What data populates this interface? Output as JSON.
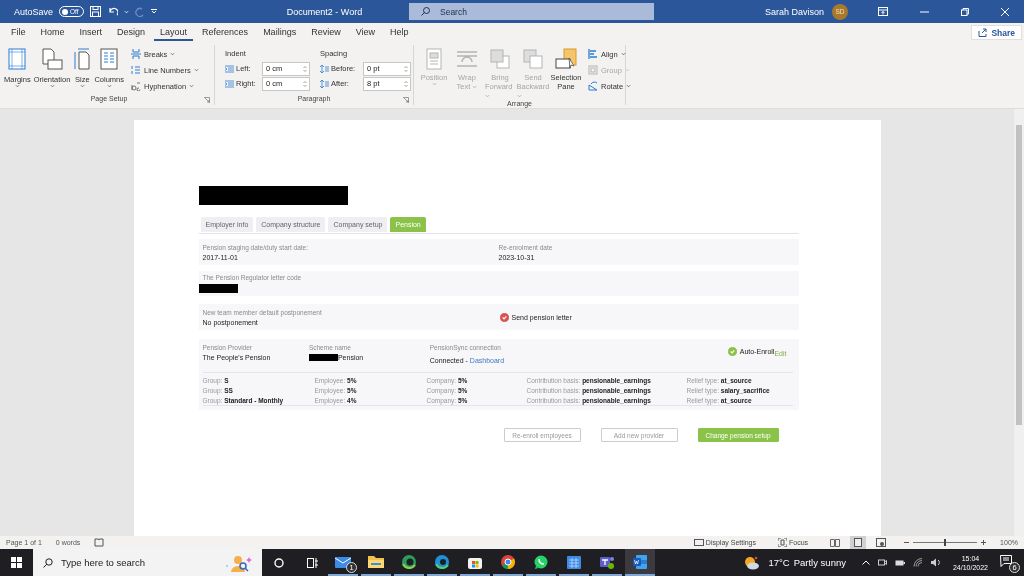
{
  "title_bar": {
    "autosave_label": "AutoSave",
    "autosave": {
      "label": "Off",
      "on": false
    },
    "document_title": "Document2  -  Word",
    "search": {
      "placeholder": "Search"
    },
    "user_name": "Sarah Davison",
    "initials": "SD"
  },
  "menu_tabs": [
    {
      "label": "File",
      "selected": false
    },
    {
      "label": "Home",
      "selected": false
    },
    {
      "label": "Insert",
      "selected": false
    },
    {
      "label": "Design",
      "selected": false
    },
    {
      "label": "Layout",
      "selected": true
    },
    {
      "label": "References",
      "selected": false
    },
    {
      "label": "Mailings",
      "selected": false
    },
    {
      "label": "Review",
      "selected": false
    },
    {
      "label": "View",
      "selected": false
    },
    {
      "label": "Help",
      "selected": false
    }
  ],
  "share": "Share",
  "ribbon": {
    "page_setup": {
      "label": "Page Setup",
      "large_buttons": [
        {
          "label": "Margins"
        },
        {
          "label": "Orientation"
        },
        {
          "label": "Size"
        },
        {
          "label": "Columns"
        }
      ],
      "small_buttons": [
        {
          "label": "Breaks"
        },
        {
          "label": "Line Numbers"
        },
        {
          "label": "Hyphenation"
        }
      ]
    },
    "paragraph": {
      "label": "Paragraph",
      "indent": {
        "heading": "Indent",
        "fields": [
          {
            "label": "Left:",
            "value": "0 cm"
          },
          {
            "label": "Right:",
            "value": "0 cm"
          }
        ]
      },
      "spacing": {
        "heading": "Spacing",
        "fields": [
          {
            "label": "Before:",
            "value": "0 pt"
          },
          {
            "label": "After:",
            "value": "8 pt"
          }
        ]
      }
    },
    "arrange": {
      "label": "Arrange",
      "large_buttons": [
        {
          "lines": [
            "Position"
          ],
          "disabled": true,
          "dropdown": true
        },
        {
          "lines": [
            "Wrap",
            "Text"
          ],
          "disabled": true,
          "dropdown": true
        },
        {
          "lines": [
            "Bring",
            "Forward"
          ],
          "disabled": true,
          "dropdown": true
        },
        {
          "lines": [
            "Send",
            "Backward"
          ],
          "disabled": true,
          "dropdown": true
        },
        {
          "lines": [
            "Selection",
            "Pane"
          ],
          "disabled": false,
          "dropdown": false
        }
      ],
      "small_buttons": [
        {
          "label": "Align",
          "disabled": false
        },
        {
          "label": "Group",
          "disabled": true
        },
        {
          "label": "Rotate",
          "disabled": false
        }
      ]
    }
  },
  "document": {
    "heading": {
      "redacted": true
    },
    "tabs": [
      {
        "label": "Employer info",
        "selected": false
      },
      {
        "label": "Company structure",
        "selected": false
      },
      {
        "label": "Company setup",
        "selected": false
      },
      {
        "label": "Pension",
        "selected": true
      }
    ],
    "dates_card": [
      {
        "label": "Pension staging date/duty start date:",
        "value": "2017-11-01"
      },
      {
        "label": "Re-enrolment date",
        "value": "2023-10-31"
      }
    ],
    "letter_code": {
      "label": "The Pension Regulator letter code",
      "redacted": true
    },
    "postponement": {
      "label": "New team member default postponement",
      "value": "No postponement",
      "send_letter": {
        "label": "Send pension letter",
        "checked": true
      }
    },
    "provider": {
      "provider_label": "Pension Provider",
      "provider": "The People's Pension",
      "scheme_label": "Scheme name",
      "scheme": {
        "redacted": true,
        "text": "Pension"
      },
      "connection_label": "PensionSync connection",
      "connection": "Connected - ",
      "dashboard_link": "Dashboard",
      "auto_enroll": {
        "label": "Auto-Enroll",
        "checked": true
      },
      "edit": "Edit",
      "groups": [
        [
          {
            "label": "Group: ",
            "value": "S"
          },
          {
            "label": "Employee: ",
            "value": "5%"
          },
          {
            "label": "Company: ",
            "value": "5%"
          },
          {
            "label": "Contribution basis: ",
            "value": "pensionable_earnings"
          },
          {
            "label": "Relief type: ",
            "value": "at_source"
          }
        ],
        [
          {
            "label": "Group: ",
            "value": "SS"
          },
          {
            "label": "Employee: ",
            "value": "5%"
          },
          {
            "label": "Company: ",
            "value": "5%"
          },
          {
            "label": "Contribution basis: ",
            "value": "pensionable_earnings"
          },
          {
            "label": "Relief type: ",
            "value": "salary_sacrifice"
          }
        ],
        [
          {
            "label": "Group: ",
            "value": "Standard - Monthly"
          },
          {
            "label": "Employee: ",
            "value": "4%"
          },
          {
            "label": "Company: ",
            "value": "5%"
          },
          {
            "label": "Contribution basis: ",
            "value": "pensionable_earnings"
          },
          {
            "label": "Relief type: ",
            "value": "at_source"
          }
        ]
      ]
    },
    "buttons": [
      {
        "label": "Re-enroll employees",
        "kind": "secondary"
      },
      {
        "label": "Add new provider",
        "kind": "secondary"
      },
      {
        "label": "Change pension setup",
        "kind": "primary"
      }
    ]
  },
  "status_bar": {
    "page": "Page 1 of 1",
    "words": "0 words",
    "display_settings": "Display Settings",
    "focus": "Focus",
    "zoom": {
      "level": 0.5
    },
    "zoom_reading": "100%"
  },
  "taskbar": {
    "search": {
      "placeholder": "Type here to search"
    },
    "apps": [
      {
        "badge": "1",
        "active": false
      },
      {
        "active": false
      },
      {
        "active": false
      },
      {
        "active": false
      },
      {
        "active": false
      },
      {
        "active": false
      },
      {
        "active": false
      },
      {
        "active": false
      },
      {
        "active": false
      },
      {
        "active": true
      }
    ],
    "temperature": "17°C",
    "weather": "Partly sunny",
    "time": "15:04",
    "date": "24/10/2022",
    "notifications": "6"
  }
}
